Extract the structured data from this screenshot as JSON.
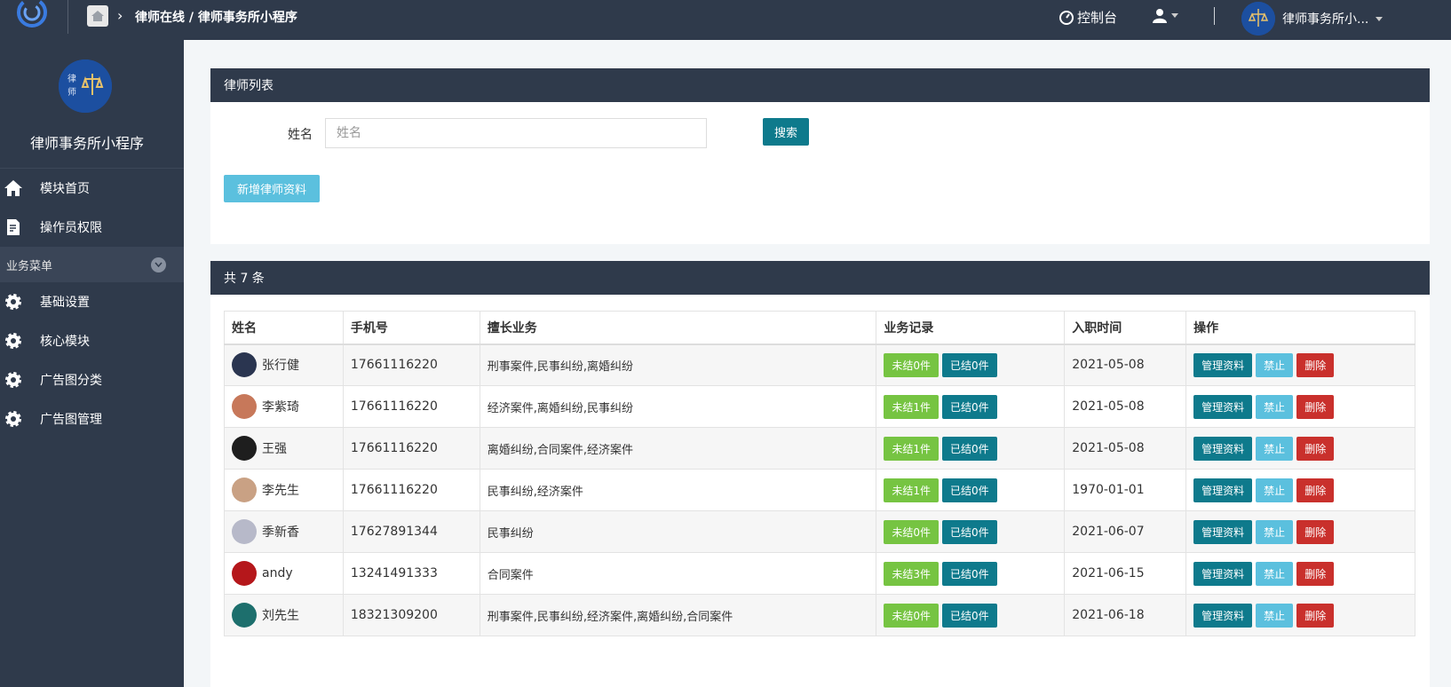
{
  "header": {
    "breadcrumb": "律师在线 / 律师事务所小程序",
    "console_label": "控制台",
    "account_name": "律师事务所小..."
  },
  "sidebar": {
    "app_name": "律师事务所小程序",
    "items": [
      {
        "label": "模块首页",
        "icon": "home-icon"
      },
      {
        "label": "操作员权限",
        "icon": "edit-icon"
      }
    ],
    "group_label": "业务菜单",
    "group_items": [
      {
        "label": "基础设置",
        "icon": "gear-icon"
      },
      {
        "label": "核心模块",
        "icon": "gear-icon"
      },
      {
        "label": "广告图分类",
        "icon": "gear-icon"
      },
      {
        "label": "广告图管理",
        "icon": "gear-icon"
      }
    ]
  },
  "search_panel": {
    "title": "律师列表",
    "name_label": "姓名",
    "name_placeholder": "姓名",
    "search_button": "搜索",
    "add_button": "新增律师资料"
  },
  "list_panel": {
    "count_text": "共 7 条",
    "columns": [
      "姓名",
      "手机号",
      "擅长业务",
      "业务记录",
      "入职时间",
      "操作"
    ],
    "actions": {
      "manage": "管理资料",
      "disable": "禁止",
      "delete": "删除"
    },
    "rows": [
      {
        "name": "张行健",
        "phone": "17661116220",
        "skills": "刑事案件,民事纠纷,离婚纠纷",
        "pending": "未结0件",
        "closed": "已结0件",
        "date": "2021-05-08",
        "avatar_color": "#2a3550"
      },
      {
        "name": "李紫琦",
        "phone": "17661116220",
        "skills": "经济案件,离婚纠纷,民事纠纷",
        "pending": "未结1件",
        "closed": "已结0件",
        "date": "2021-05-08",
        "avatar_color": "#c7785a"
      },
      {
        "name": "王强",
        "phone": "17661116220",
        "skills": "离婚纠纷,合同案件,经济案件",
        "pending": "未结1件",
        "closed": "已结0件",
        "date": "2021-05-08",
        "avatar_color": "#1e1e1e"
      },
      {
        "name": "李先生",
        "phone": "17661116220",
        "skills": "民事纠纷,经济案件",
        "pending": "未结1件",
        "closed": "已结0件",
        "date": "1970-01-01",
        "avatar_color": "#c9a184"
      },
      {
        "name": "季新香",
        "phone": "17627891344",
        "skills": "民事纠纷",
        "pending": "未结0件",
        "closed": "已结0件",
        "date": "2021-06-07",
        "avatar_color": "#b7b9c9"
      },
      {
        "name": "andy",
        "phone": "13241491333",
        "skills": "合同案件",
        "pending": "未结3件",
        "closed": "已结0件",
        "date": "2021-06-15",
        "avatar_color": "#b5171b"
      },
      {
        "name": "刘先生",
        "phone": "18321309200",
        "skills": "刑事案件,民事纠纷,经济案件,离婚纠纷,合同案件",
        "pending": "未结0件",
        "closed": "已结0件",
        "date": "2021-06-18",
        "avatar_color": "#1d6f6d"
      }
    ]
  },
  "colors": {
    "nav_bg": "#2f3a4b",
    "teal": "#0e7a8c",
    "green": "#76c442",
    "light_blue": "#5bc0de",
    "red": "#c9302c"
  }
}
